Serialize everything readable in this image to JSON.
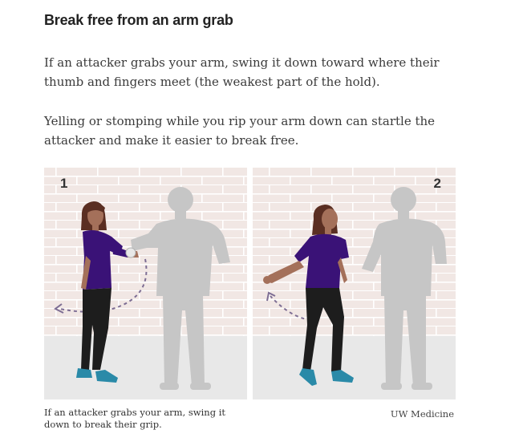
{
  "heading": "Break free from an arm grab",
  "paragraphs": [
    "If an attacker grabs your arm, swing it down toward where their thumb and fingers meet (the weakest part of the hold).",
    "Yelling or stomping while you rip your arm down can startle the attacker and make it easier to break free."
  ],
  "illustration": {
    "panels": [
      {
        "number": "1",
        "icon": "woman-arm-grabbed-illustration"
      },
      {
        "number": "2",
        "icon": "woman-breaking-free-illustration"
      }
    ],
    "colors": {
      "brick_wall": "#f1e7e4",
      "mortar": "#ffffff",
      "floor": "#e8e8e8",
      "attacker": "#c6c6c6",
      "shirt": "#3a1277",
      "pants": "#1d1d1d",
      "shoes": "#2a8aa8",
      "skin": "#a4705a",
      "hair": "#5a2e22",
      "motion_arrow": "#7d6d93"
    }
  },
  "caption": "If an attacker grabs your arm, swing it down to break their grip.",
  "credit": "UW Medicine"
}
